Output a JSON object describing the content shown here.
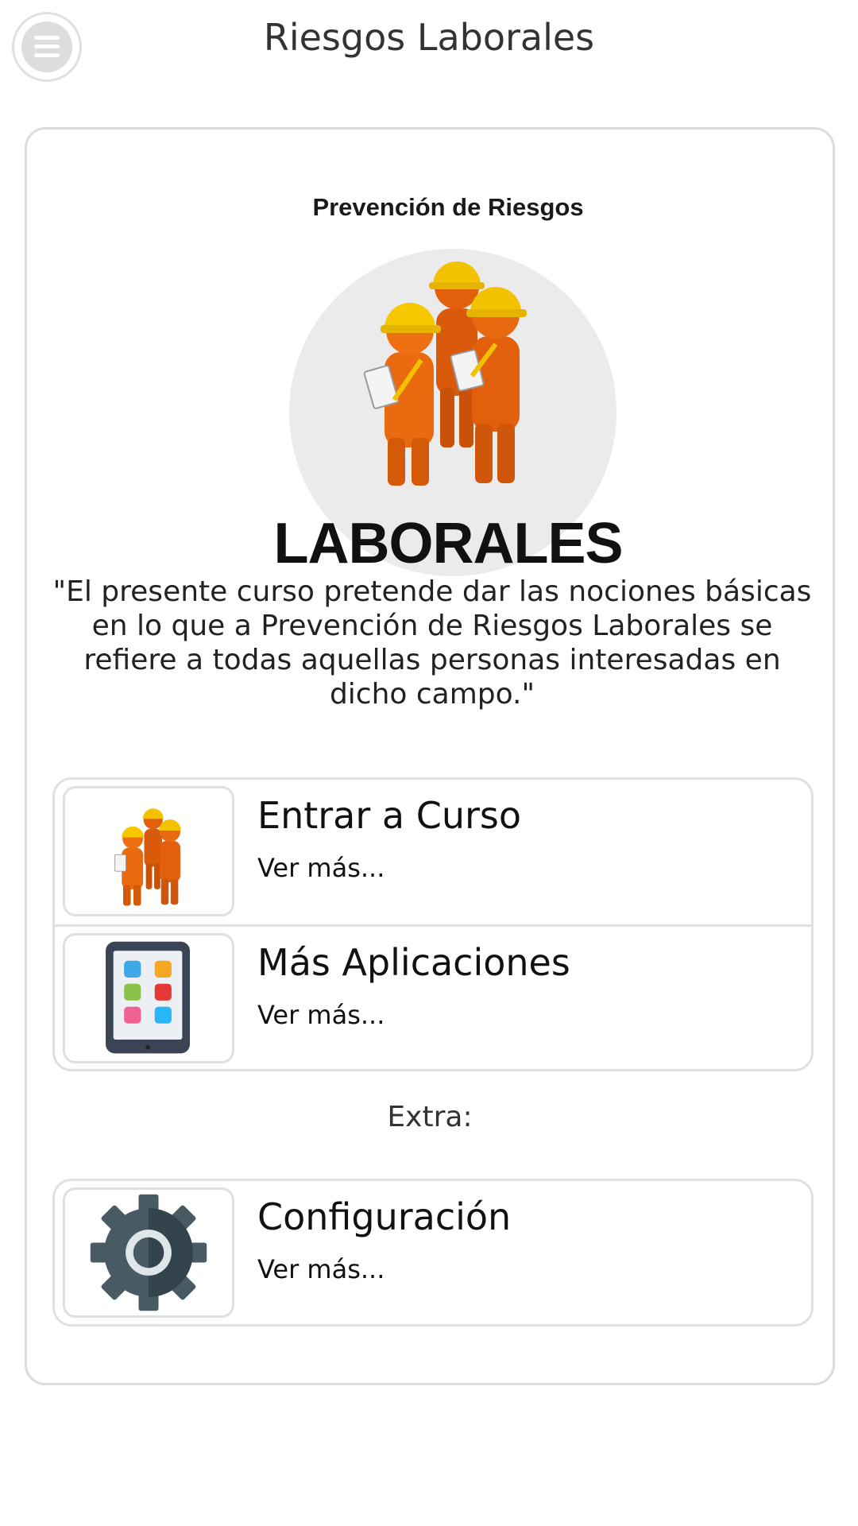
{
  "header": {
    "title": "Riesgos Laborales",
    "menu_icon": "hamburger-icon"
  },
  "logo": {
    "top_text": "Prevención de Riesgos",
    "bottom_text": "LABORALES",
    "icon": "workers-hardhat-icon"
  },
  "intro_text": "\"El presente curso pretende dar las nociones básicas en lo que a Prevención de Riesgos Laborales se refiere a todas aquellas personas interesadas en dicho campo.\"",
  "menu_items": [
    {
      "title": "Entrar a Curso",
      "subtitle": "Ver más...",
      "icon": "workers-icon"
    },
    {
      "title": "Más Aplicaciones",
      "subtitle": "Ver más...",
      "icon": "tablet-apps-icon"
    }
  ],
  "extra_label": "Extra:",
  "extra_items": [
    {
      "title": "Configuración",
      "subtitle": "Ver más...",
      "icon": "gear-icon"
    }
  ],
  "colors": {
    "worker_orange": "#e2600c",
    "hardhat_yellow": "#f2c200",
    "tablet_dark": "#3b4454",
    "gear_dark": "#485a63"
  }
}
